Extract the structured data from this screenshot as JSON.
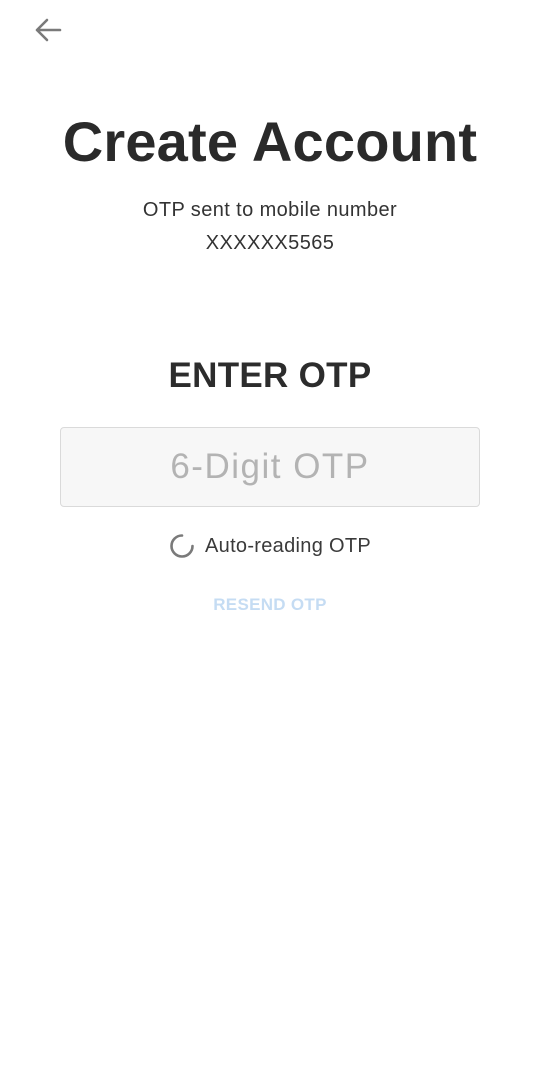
{
  "header": {
    "back_icon": "arrow-left-icon"
  },
  "title": "Create Account",
  "subtitle": {
    "line1": "OTP sent to mobile number",
    "line2": "XXXXXX5565"
  },
  "otp_section": {
    "heading": "ENTER OTP",
    "input_value": "",
    "input_placeholder": "6-Digit OTP"
  },
  "auto_read": {
    "icon": "loading-spinner-icon",
    "label": "Auto-reading OTP"
  },
  "resend": {
    "label": "RESEND OTP",
    "state": "disabled"
  },
  "colors": {
    "title": "#2a2a2a",
    "input_background": "#f7f7f7",
    "input_border": "#dadada",
    "placeholder": "#b3b3b3",
    "resend_disabled": "#c5dcf3",
    "icon_gray": "#7a7a7a"
  }
}
